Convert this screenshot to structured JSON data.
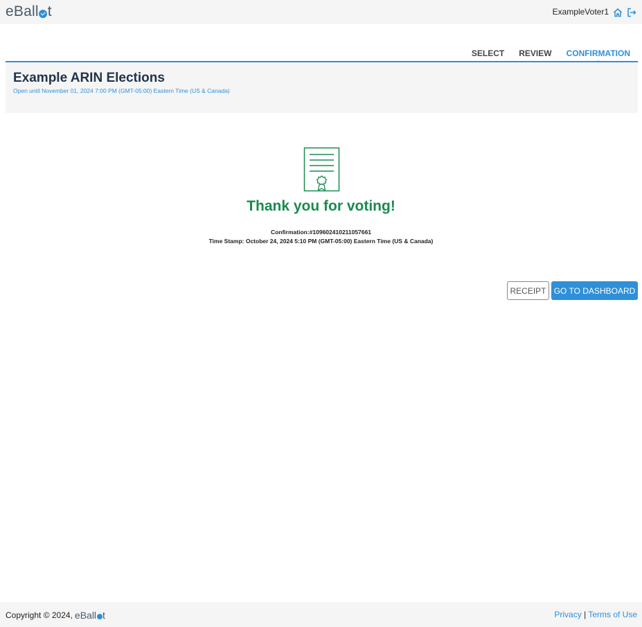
{
  "header": {
    "logo_text_before": "eBall",
    "logo_text_after": "t",
    "username": "ExampleVoter1",
    "icons": [
      "home-icon",
      "logout-icon"
    ]
  },
  "steps": [
    {
      "label": "SELECT",
      "active": false
    },
    {
      "label": "REVIEW",
      "active": false
    },
    {
      "label": "CONFIRMATION",
      "active": true
    }
  ],
  "election": {
    "title": "Example ARIN Elections",
    "subtitle": "Open until November 01, 2024 7:00 PM (GMT-05:00) Eastern Time (US & Canada)"
  },
  "confirmation": {
    "icon": "certificate-icon",
    "heading": "Thank you for voting!",
    "confirmation_number": "Confirmation:#109602410211057661",
    "timestamp": "Time Stamp: October 24, 2024 5:10 PM (GMT-05:00) Eastern Time (US & Canada)"
  },
  "actions": {
    "receipt_label": "RECEIPT",
    "dashboard_label": "GO TO DASHBOARD"
  },
  "footer": {
    "copyright": "Copyright © 2024,",
    "logo_text_before": "eBall",
    "logo_text_after": "t",
    "privacy_label": "Privacy",
    "separator": "|",
    "terms_label": "Terms of Use"
  },
  "colors": {
    "accent": "#2f8fd8",
    "success": "#1a8a4e",
    "title": "#22334a",
    "panel_bg": "#f5f5f5"
  }
}
